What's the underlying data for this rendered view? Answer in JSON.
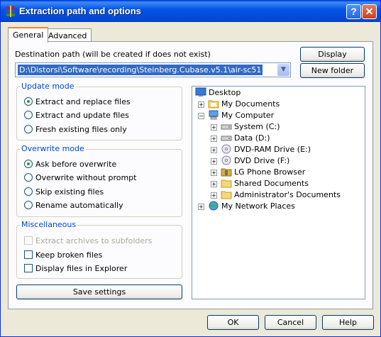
{
  "window": {
    "title": "Extraction path and options",
    "help_glyph": "?",
    "close_glyph": "✕"
  },
  "tabs": [
    {
      "label": "General"
    },
    {
      "label": "Advanced"
    }
  ],
  "destination": {
    "label": "Destination path (will be created if does not exist)",
    "value": "D:\\Distorsi\\Software\\recording\\Steinberg.Cubase.v5.1\\air-sc51"
  },
  "buttons": {
    "display": "Display",
    "new_folder": "New folder",
    "save_settings": "Save settings",
    "ok": "OK",
    "cancel": "Cancel",
    "help": "Help"
  },
  "update_mode": {
    "title": "Update mode",
    "options": [
      {
        "label": "Extract and replace files",
        "selected": true
      },
      {
        "label": "Extract and update files",
        "selected": false
      },
      {
        "label": "Fresh existing files only",
        "selected": false
      }
    ]
  },
  "overwrite_mode": {
    "title": "Overwrite mode",
    "options": [
      {
        "label": "Ask before overwrite",
        "selected": true
      },
      {
        "label": "Overwrite without prompt",
        "selected": false
      },
      {
        "label": "Skip existing files",
        "selected": false
      },
      {
        "label": "Rename automatically",
        "selected": false
      }
    ]
  },
  "misc": {
    "title": "Miscellaneous",
    "options": [
      {
        "label": "Extract archives to subfolders",
        "checked": false,
        "enabled": false
      },
      {
        "label": "Keep broken files",
        "checked": false,
        "enabled": true
      },
      {
        "label": "Display files in Explorer",
        "checked": false,
        "enabled": true
      }
    ]
  },
  "tree": [
    {
      "label": "Desktop",
      "icon": "desktop-icon"
    },
    {
      "label": "My Documents",
      "icon": "folder-documents-icon",
      "expander": "+"
    },
    {
      "label": "My Computer",
      "icon": "computer-icon",
      "expander": "−"
    },
    {
      "label": "System (C:)",
      "icon": "drive-icon",
      "expander": "+"
    },
    {
      "label": "Data (D:)",
      "icon": "drive-icon",
      "expander": "+"
    },
    {
      "label": "DVD-RAM Drive (E:)",
      "icon": "dvd-drive-icon",
      "expander": "+"
    },
    {
      "label": "DVD Drive (F:)",
      "icon": "dvd-drive-icon",
      "expander": "+"
    },
    {
      "label": "LG Phone Browser",
      "icon": "phone-folder-icon",
      "expander": "+"
    },
    {
      "label": "Shared Documents",
      "icon": "folder-icon",
      "expander": "+"
    },
    {
      "label": "Administrator's Documents",
      "icon": "folder-icon",
      "expander": "+"
    },
    {
      "label": "My Network Places",
      "icon": "network-icon",
      "expander": "+"
    }
  ]
}
